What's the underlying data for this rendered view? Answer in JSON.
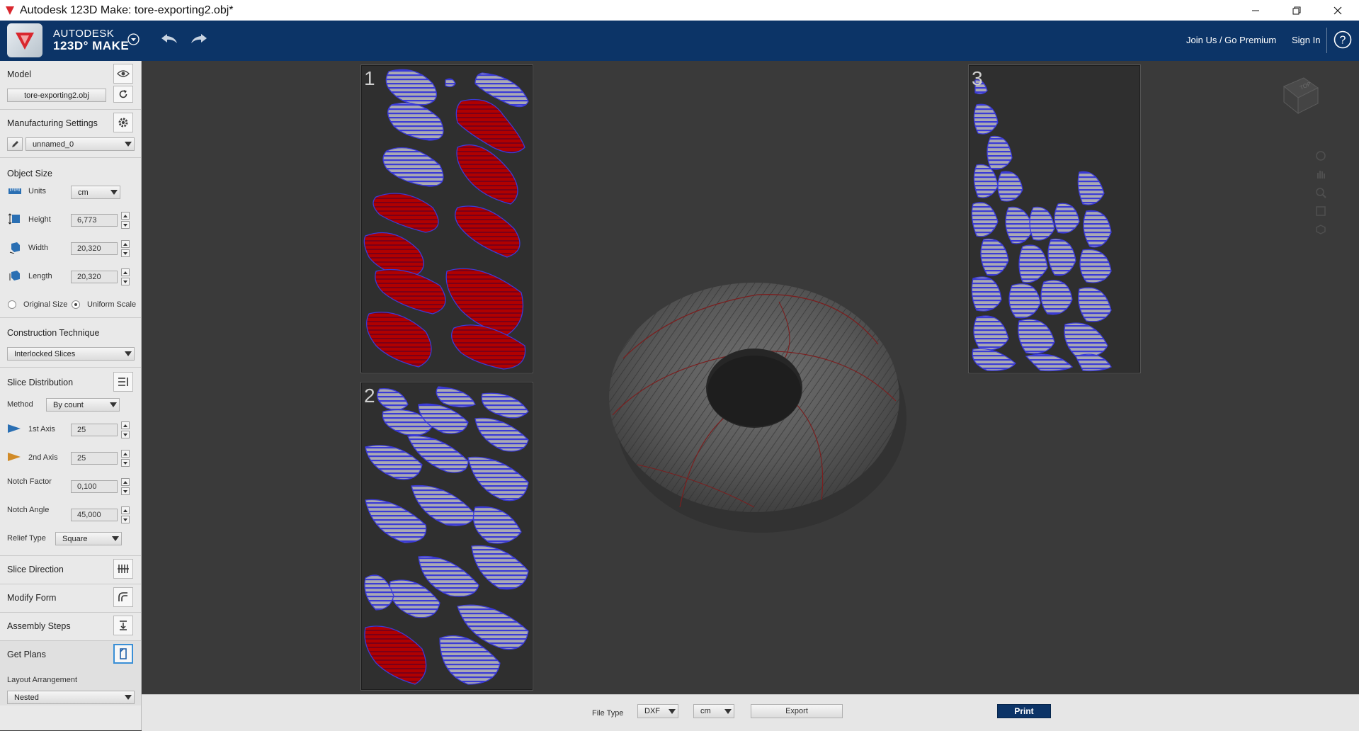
{
  "window": {
    "title": "Autodesk 123D Make: tore-exporting2.obj*"
  },
  "appbar": {
    "brand_top": "AUTODESK",
    "brand_bottom": "123D° MAKE",
    "join_label": "Join Us / Go Premium",
    "signin_label": "Sign In"
  },
  "sidebar": {
    "model": {
      "title": "Model",
      "file_name": "tore-exporting2.obj"
    },
    "manufacturing": {
      "title": "Manufacturing Settings",
      "preset": "unnamed_0"
    },
    "object_size": {
      "title": "Object Size",
      "units_label": "Units",
      "units_value": "cm",
      "height_label": "Height",
      "height_value": "6,773",
      "width_label": "Width",
      "width_value": "20,320",
      "length_label": "Length",
      "length_value": "20,320",
      "original_size_label": "Original Size",
      "uniform_scale_label": "Uniform Scale"
    },
    "construction": {
      "title": "Construction Technique",
      "value": "Interlocked Slices"
    },
    "slice_distribution": {
      "title": "Slice Distribution",
      "method_label": "Method",
      "method_value": "By count",
      "axis1_label": "1st Axis",
      "axis1_value": "25",
      "axis2_label": "2nd Axis",
      "axis2_value": "25",
      "notch_factor_label": "Notch Factor",
      "notch_factor_value": "0,100",
      "notch_angle_label": "Notch Angle",
      "notch_angle_value": "45,000",
      "relief_label": "Relief Type",
      "relief_value": "Square"
    },
    "slice_direction": {
      "title": "Slice Direction"
    },
    "modify_form": {
      "title": "Modify Form"
    },
    "assembly_steps": {
      "title": "Assembly Steps"
    },
    "get_plans": {
      "title": "Get Plans",
      "layout_label": "Layout Arrangement",
      "layout_value": "Nested"
    }
  },
  "sheets": [
    {
      "number": "1"
    },
    {
      "number": "2"
    },
    {
      "number": "3"
    }
  ],
  "viewcube": {
    "face_label": "TOP"
  },
  "bottom": {
    "file_type_label": "File Type",
    "file_type_value": "DXF",
    "unit_value": "cm",
    "export_label": "Export",
    "print_label": "Print"
  },
  "colors": {
    "appbar": "#0c3467",
    "sheet_bg": "#2f2f2f",
    "slice_blue": "#3b3bd6",
    "slice_red": "#c80000",
    "slice_fill": "#a9a9b3"
  }
}
